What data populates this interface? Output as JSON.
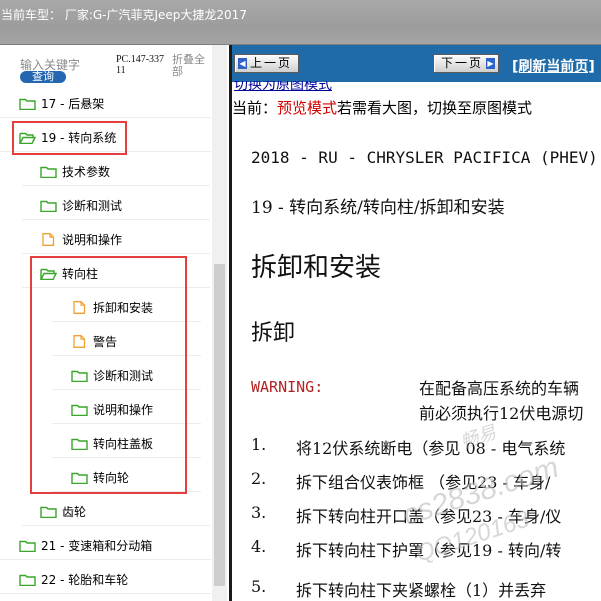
{
  "header": {
    "title": "当前车型：  厂家:G-广汽菲克Jeep大捷龙2017"
  },
  "search": {
    "keyword_placeholder": "输入关键字",
    "query_button": "查询",
    "pc_code": "PC.147-33711",
    "fold_all": "折叠全部"
  },
  "tree": [
    {
      "label": "17 - 后悬架",
      "icon": "folder-green-icon"
    },
    {
      "label": "19 - 转向系统",
      "icon": "folder-open-green-icon"
    },
    {
      "label": "技术参数",
      "icon": "folder-green-icon"
    },
    {
      "label": "诊断和测试",
      "icon": "folder-green-icon"
    },
    {
      "label": "说明和操作",
      "icon": "document-orange-icon"
    },
    {
      "label": "转向柱",
      "icon": "folder-open-green-icon"
    },
    {
      "label": "拆卸和安装",
      "icon": "document-orange-icon"
    },
    {
      "label": "警告",
      "icon": "document-orange-icon"
    },
    {
      "label": "诊断和测试",
      "icon": "folder-green-icon"
    },
    {
      "label": "说明和操作",
      "icon": "folder-green-icon"
    },
    {
      "label": "转向柱盖板",
      "icon": "folder-green-icon"
    },
    {
      "label": "转向轮",
      "icon": "folder-green-icon"
    },
    {
      "label": "齿轮",
      "icon": "folder-green-icon"
    },
    {
      "label": "21 - 变速箱和分动箱",
      "icon": "folder-green-icon"
    },
    {
      "label": "22 - 轮胎和车轮",
      "icon": "folder-green-icon"
    }
  ],
  "nav": {
    "prev": "上一页",
    "next": "下一页",
    "refresh": "[刷新当前页]"
  },
  "doc": {
    "switch_link": "切换为原图模式",
    "mode_prefix": "当前：",
    "mode_value": "预览模式",
    "mode_suffix": "若需看大图，切换至原图模式",
    "vehicle": "2018 - RU - CHRYSLER PACIFICA (PHEV)",
    "breadcrumb": "19 - 转向系统/转向柱/拆卸和安装",
    "h1": "拆卸和安装",
    "h2": "拆卸",
    "warning_label": "WARNING:",
    "warning_line1": "在配备高压系统的车辆",
    "warning_line2": "前必须执行12伏电源切",
    "steps": [
      {
        "num": "1.",
        "text": "将12伏系统断电（参见 08 - 电气系统"
      },
      {
        "num": "2.",
        "text": "拆下组合仪表饰框  （参见23 - 车身/"
      },
      {
        "num": "3.",
        "text": "拆下转向柱开口盖（参见23 - 车身/仪"
      },
      {
        "num": "4.",
        "text": "拆下转向柱下护罩（参见19 - 转向/转"
      },
      {
        "num": "5.",
        "text": "拆下转向柱下夹紧螺栓（1）并丢弃"
      }
    ]
  },
  "watermark": {
    "line1": "畅易",
    "line2": "cs2838.com",
    "line3": "QQ120163"
  },
  "colors": {
    "navbar": "#1f6aa8",
    "highlight_box": "#e53e3e",
    "mode_red": "#d40000",
    "folder_green": "#3aa52a",
    "doc_orange": "#f0a030"
  }
}
